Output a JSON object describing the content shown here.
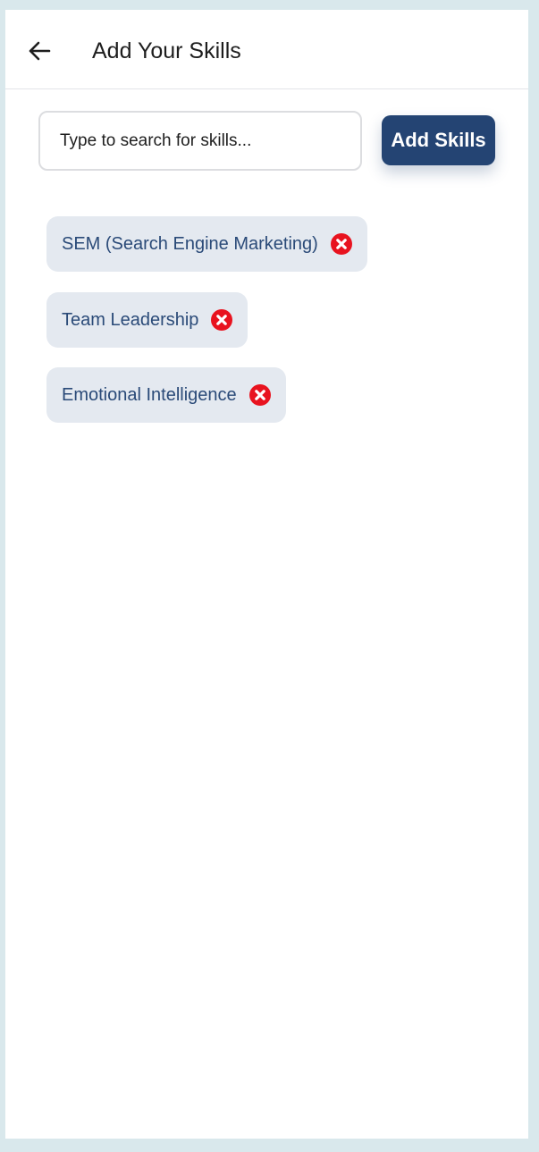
{
  "header": {
    "title": "Add Your Skills",
    "back_icon": "arrow-left-icon"
  },
  "search": {
    "placeholder": "Type to search for skills...",
    "value": ""
  },
  "actions": {
    "add_label": "Add Skills"
  },
  "skills": [
    {
      "label": "SEM (Search Engine Marketing)",
      "remove_icon": "remove-icon"
    },
    {
      "label": "Team Leadership",
      "remove_icon": "remove-icon"
    },
    {
      "label": "Emotional Intelligence",
      "remove_icon": "remove-icon"
    }
  ],
  "colors": {
    "page_background": "#d9e8ec",
    "card_background": "#ffffff",
    "primary": "#244473",
    "chip_background": "#e4e9f0",
    "chip_text": "#2a4a78",
    "remove": "#e8131f"
  }
}
